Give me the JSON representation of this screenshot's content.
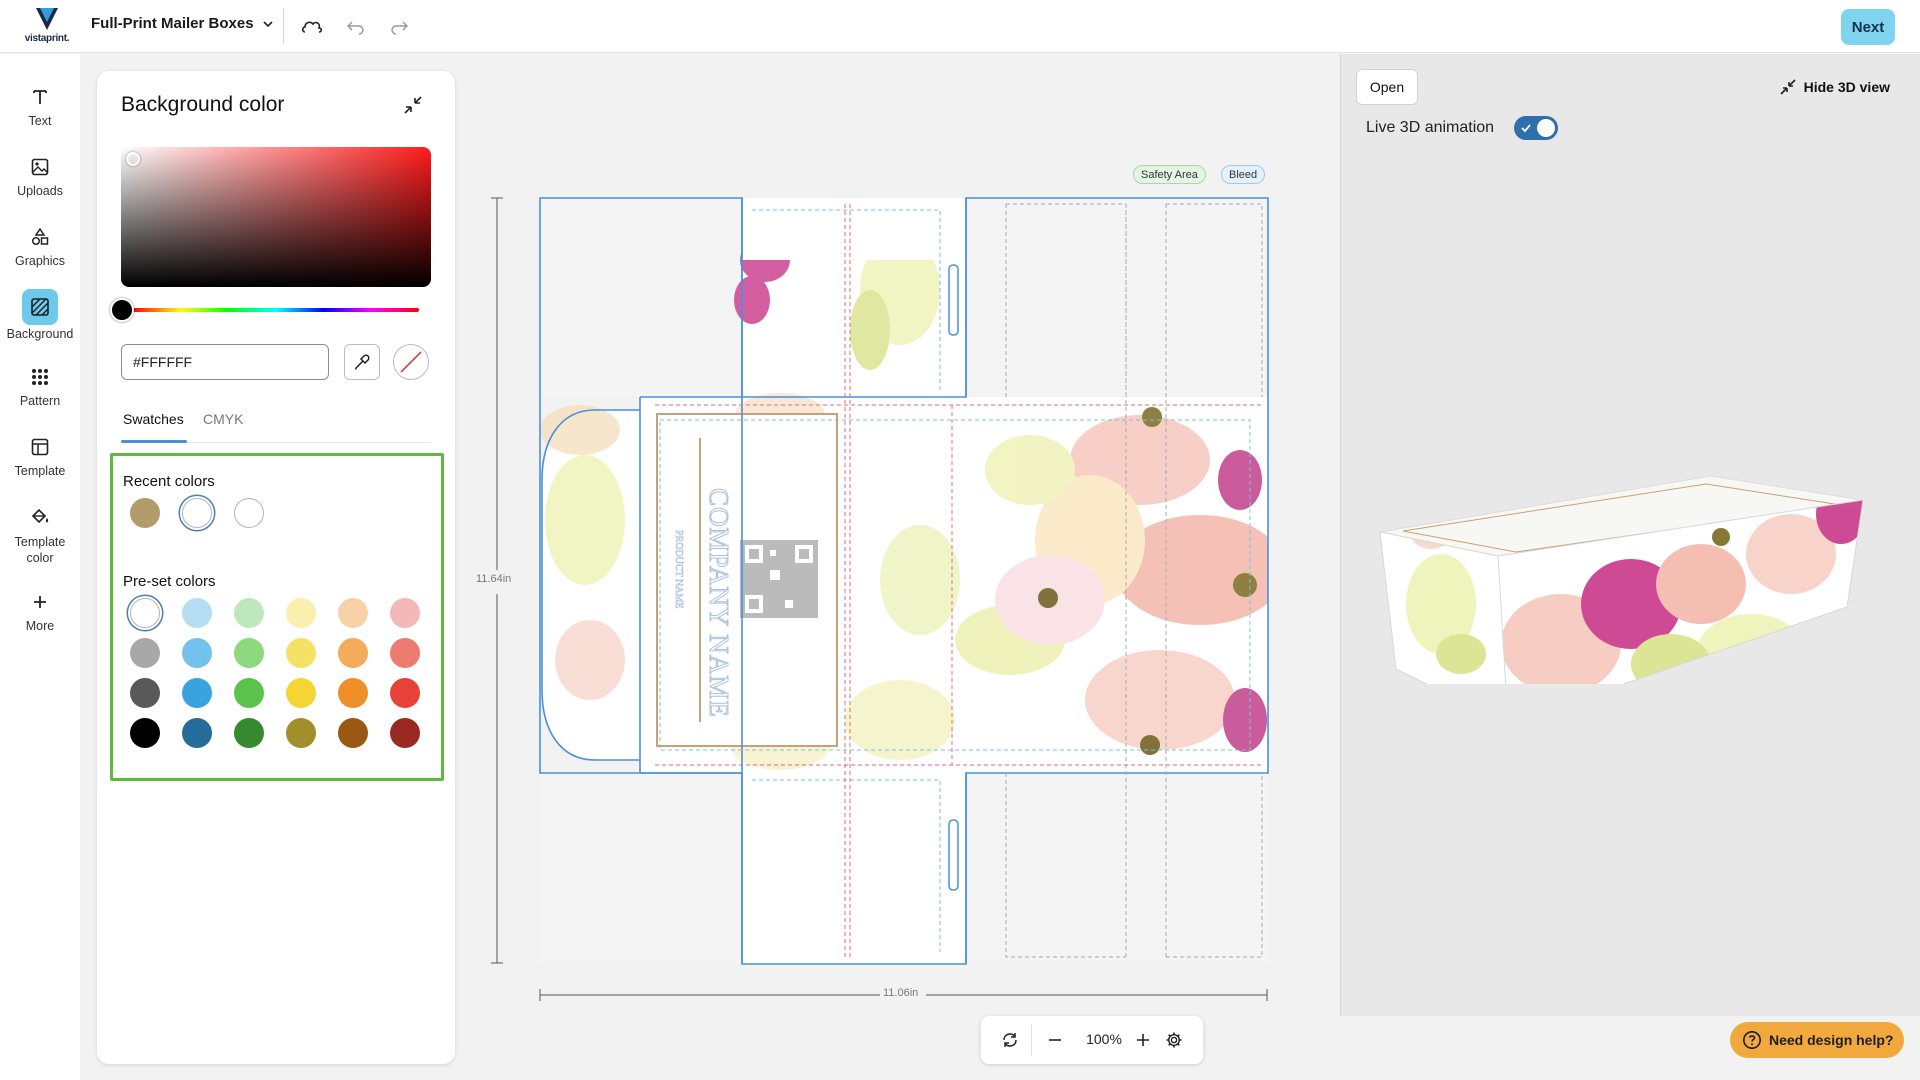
{
  "app": {
    "logo_text": "vistaprint.",
    "product_name": "Full-Print Mailer Boxes",
    "next_label": "Next"
  },
  "rail": [
    {
      "label": "Text",
      "icon": "text-icon"
    },
    {
      "label": "Uploads",
      "icon": "image-icon"
    },
    {
      "label": "Graphics",
      "icon": "shapes-icon"
    },
    {
      "label": "Background",
      "icon": "background-icon",
      "active": true
    },
    {
      "label": "Pattern",
      "icon": "grid-dots-icon"
    },
    {
      "label": "Template",
      "icon": "template-icon"
    },
    {
      "label": "Template color",
      "icon": "paint-bucket-icon"
    },
    {
      "label": "More",
      "icon": "plus-icon"
    }
  ],
  "panel": {
    "title": "Background color",
    "hex_value": "#FFFFFF",
    "tabs": [
      "Swatches",
      "CMYK"
    ],
    "recent_label": "Recent colors",
    "preset_label": "Pre-set colors",
    "recent_colors": [
      "#b39c6a",
      "#ffffff",
      "#ffffff"
    ],
    "preset_colors": [
      [
        "#ffffff",
        "#b5ddf3",
        "#bde8bd",
        "#fbefae",
        "#f7d2a9",
        "#f4b9b6"
      ],
      [
        "#a8a8a8",
        "#74c2ec",
        "#8ed880",
        "#f5e165",
        "#f2ac5a",
        "#ee7b70"
      ],
      [
        "#595959",
        "#3aa2de",
        "#5ac44a",
        "#f5d534",
        "#ee8f27",
        "#e8413a"
      ],
      [
        "#000000",
        "#256c98",
        "#37892f",
        "#a08f2a",
        "#9a5813",
        "#9a2924"
      ]
    ]
  },
  "canvas": {
    "safety_label": "Safety Area",
    "bleed_label": "Bleed",
    "height_label": "11.64in",
    "width_label": "11.06in",
    "company_text": "COMPANY NAME",
    "product_text": "PRODUCT NAME"
  },
  "zoom": {
    "value": "100%"
  },
  "preview": {
    "open_label": "Open",
    "hide_label": "Hide 3D view",
    "live_label": "Live 3D animation",
    "live_enabled": true
  },
  "help": {
    "label": "Need design help?"
  },
  "colors": {
    "accent": "#6fc9ec",
    "highlight_border": "#5cbb3e",
    "help_bg": "#f1a83c",
    "toggle": "#2e6fae"
  }
}
